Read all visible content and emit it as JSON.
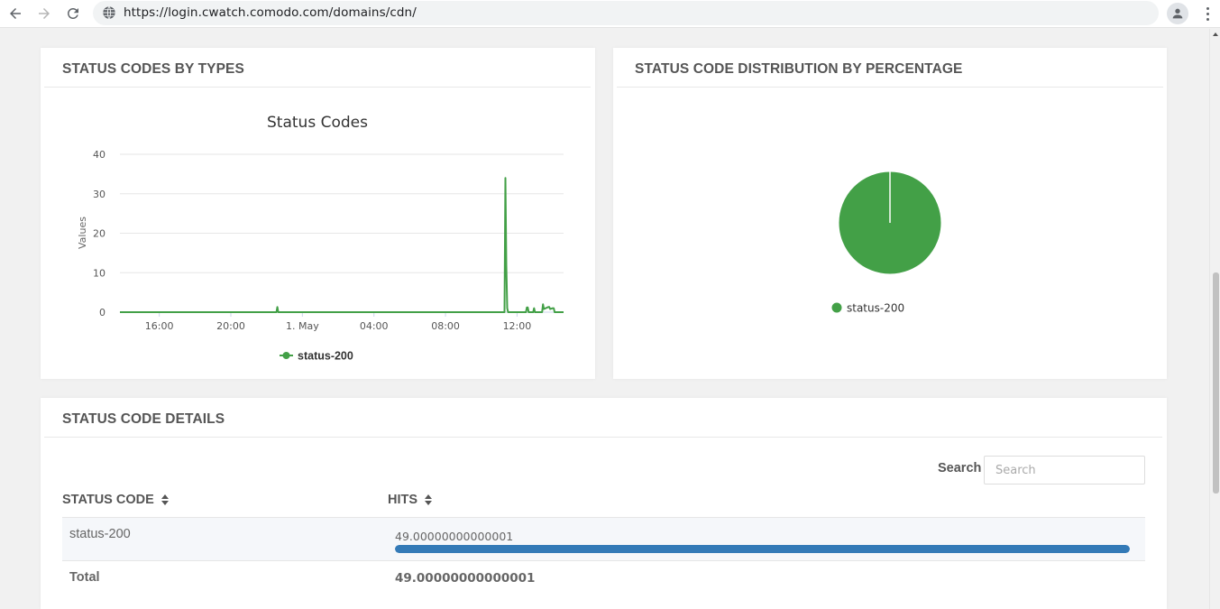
{
  "browser": {
    "url": "https://login.cwatch.comodo.com/domains/cdn/"
  },
  "panels": {
    "types_title": "STATUS CODES BY TYPES",
    "distribution_title": "STATUS CODE DISTRIBUTION BY PERCENTAGE",
    "details_title": "STATUS CODE DETAILS"
  },
  "chart_data": [
    {
      "type": "line",
      "title": "Status Codes",
      "xlabel": "",
      "ylabel": "Values",
      "ylim": [
        0,
        40
      ],
      "yticks": [
        "0",
        "10",
        "20",
        "30",
        "40"
      ],
      "xticks": [
        "16:00",
        "20:00",
        "1. May",
        "04:00",
        "08:00",
        "12:00"
      ],
      "xtick_hours": [
        16,
        20,
        24,
        28,
        32,
        36
      ],
      "xlim_hours": [
        13.8,
        38.6
      ],
      "grid": true,
      "legend_position": "bottom",
      "color": "#43a047",
      "series": [
        {
          "name": "status-200",
          "x_hours": [
            13.8,
            22.55,
            22.6,
            22.65,
            35.3,
            35.35,
            35.4,
            35.45,
            35.5,
            36.5,
            36.55,
            36.6,
            36.65,
            36.9,
            36.95,
            37.0,
            37.4,
            37.45,
            37.5,
            37.75,
            37.8,
            37.85,
            38.0,
            38.05,
            38.1,
            38.5,
            38.6
          ],
          "values": [
            0,
            0,
            1.3,
            0,
            0,
            34,
            12,
            1,
            0,
            0,
            1.2,
            1.2,
            0,
            0,
            1,
            0,
            0,
            2,
            0.8,
            1.3,
            1.3,
            0.8,
            1,
            1,
            0,
            0,
            0
          ]
        }
      ]
    },
    {
      "type": "pie",
      "title": "",
      "legend_position": "bottom",
      "slices": [
        {
          "label": "status-200",
          "value": 100,
          "color": "#43a047"
        }
      ]
    }
  ],
  "details": {
    "search_label": "Search",
    "search_placeholder": "Search",
    "columns": [
      "STATUS CODE",
      "HITS"
    ],
    "rows": [
      {
        "code": "status-200",
        "hits": "49.00000000000001",
        "fraction": 1.0
      }
    ],
    "total_label": "Total",
    "total_value": "49.00000000000001"
  },
  "colors": {
    "series_green": "#43a047",
    "bar_blue": "#337ab7"
  },
  "icons": [
    "back-arrow-icon",
    "forward-arrow-icon",
    "reload-icon",
    "globe-icon",
    "profile-icon",
    "more-vert-icon",
    "sort-icon"
  ]
}
